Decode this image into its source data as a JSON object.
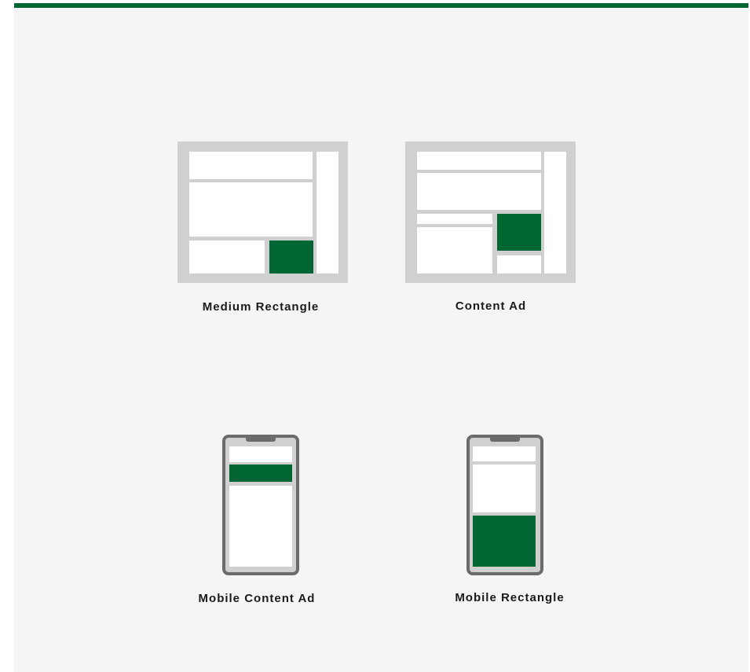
{
  "colors": {
    "accent": "#006633",
    "frame": "#d0d0d0",
    "phone_border": "#6b6b6b",
    "background": "#f5f5f5"
  },
  "ad_formats": {
    "medium_rectangle": {
      "label": "Medium Rectangle"
    },
    "content_ad": {
      "label": "Content Ad"
    },
    "mobile_content_ad": {
      "label": "Mobile Content Ad"
    },
    "mobile_rectangle": {
      "label": "Mobile Rectangle"
    }
  }
}
